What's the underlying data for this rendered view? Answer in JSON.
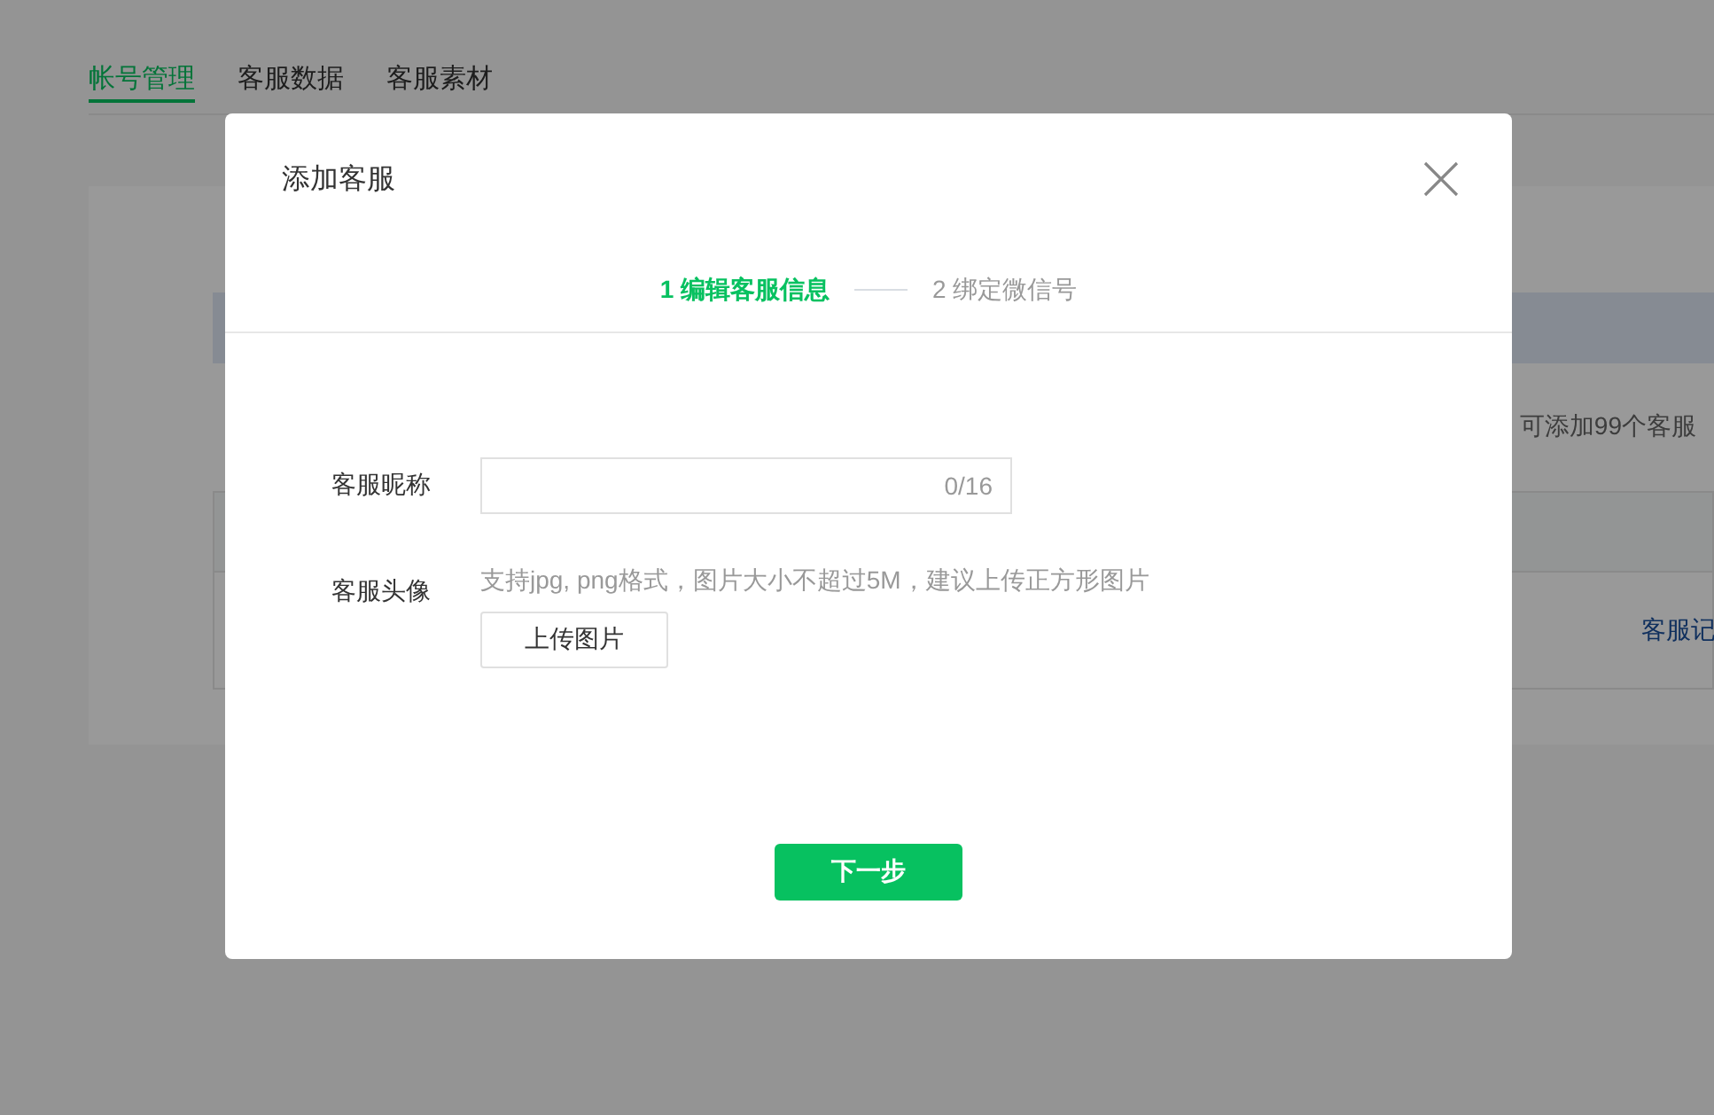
{
  "page": {
    "tabs": [
      {
        "label": "帐号管理",
        "selected": true
      },
      {
        "label": "客服数据",
        "selected": false
      },
      {
        "label": "客服素材",
        "selected": false
      }
    ],
    "quota_note": "可添加99个客服",
    "row_action": "客服记"
  },
  "dialog": {
    "title": "添加客服",
    "steps": [
      {
        "label": "1 编辑客服信息",
        "selected": true
      },
      {
        "label": "2 绑定微信号",
        "selected": false
      }
    ],
    "fields": [
      {
        "kind": "text",
        "label": "客服昵称",
        "counter": "0/16"
      },
      {
        "kind": "upload",
        "label": "客服头像",
        "hint": "支持jpg, png格式，图片大小不超过5M，建议上传正方形图片",
        "button": "上传图片"
      }
    ],
    "next_button": "下一步"
  }
}
